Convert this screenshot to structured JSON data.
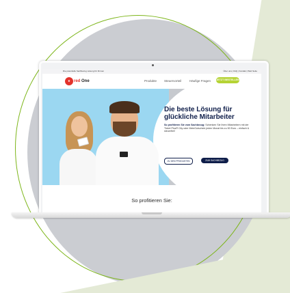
{
  "colors": {
    "brand_red": "#e3322b",
    "navy": "#0f1e4a",
    "lime": "#b5d334",
    "hero_blue": "#9bd7f1",
    "ring_green": "#7cb518"
  },
  "topbar": {
    "left_text": "Die potentielle Sachbezug Lösung für Firmen",
    "right_text": "Über uns | FAQ | Kontakt | Web Seite"
  },
  "logo": {
    "mark": "Edenred",
    "word_left": "",
    "word_right": "One"
  },
  "nav": {
    "items": [
      "Produkte",
      "Steuervorteil",
      "Häufige Fragen"
    ],
    "cta": "JETZT BESTELLEN"
  },
  "hero": {
    "title": "Die beste Lösung für glückliche Mitarbeiter",
    "desc_strong": "So profitieren Sie vom Sachbezug:",
    "desc_rest": " Schenken Sie Ihren Mitarbeitern mit der Ticket Plus® City oder MeinGutschein jeden Monat bis zu 50 Euro – einfach & steuerfrei!",
    "btn_products": "ZU DEN PRODUKTEN",
    "btn_how": "ZUM SACHBEZUG"
  },
  "section": {
    "title": "So profitieren Sie:"
  }
}
